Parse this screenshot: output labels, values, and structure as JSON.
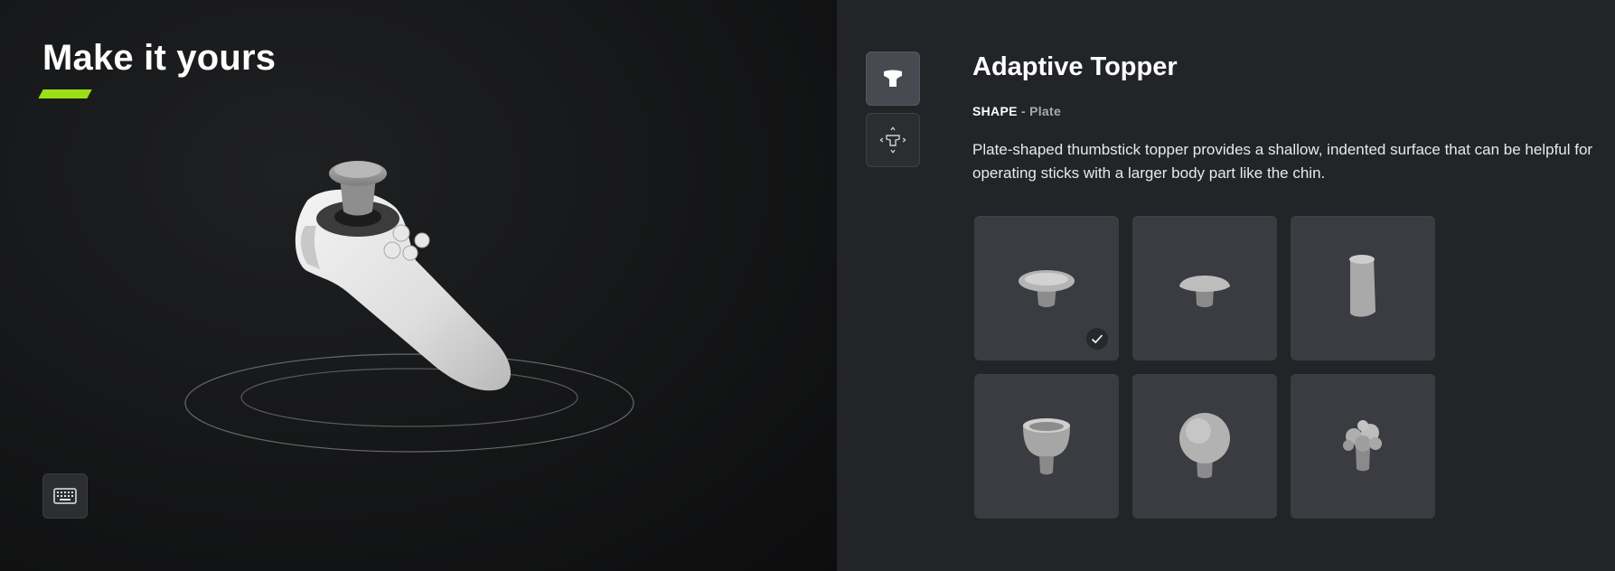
{
  "preview": {
    "title": "Make it yours",
    "accent_color": "#9be016",
    "keyboard_button_icon": "keyboard-icon"
  },
  "topper": {
    "heading": "Adaptive Topper",
    "shape_label": "SHAPE",
    "shape_separator": "-",
    "shape_value": "Plate",
    "description_line1": "Plate-shaped thumbstick topper provides a shallow, indented surface that can be helpful for",
    "description_line2": "operating sticks with a larger body part like the chin.",
    "tabs": [
      {
        "icon": "topper-icon",
        "selected": true
      },
      {
        "icon": "topper-position-icon",
        "selected": false
      }
    ],
    "options": [
      {
        "icon": "plate-topper-icon",
        "selected": true
      },
      {
        "icon": "dome-topper-icon",
        "selected": false
      },
      {
        "icon": "cylinder-topper-icon",
        "selected": false
      },
      {
        "icon": "cup-topper-icon",
        "selected": false
      },
      {
        "icon": "ball-topper-icon",
        "selected": false
      },
      {
        "icon": "textured-topper-icon",
        "selected": false
      }
    ]
  }
}
